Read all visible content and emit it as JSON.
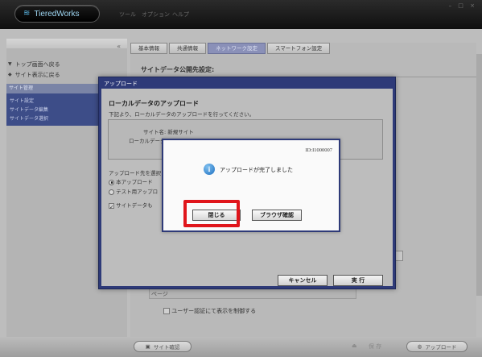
{
  "app": {
    "logo_text": "TieredWorks",
    "menu": [
      "ツール",
      "オプション",
      "ヘルプ"
    ],
    "window_controls": "– □ ×"
  },
  "sidebar": {
    "collapse": "«",
    "links": [
      {
        "label": "トップ画面へ戻る",
        "icon": "home-icon"
      },
      {
        "label": "サイト表示に戻る",
        "icon": "back-arrow-icon"
      }
    ],
    "section": "サイト管理",
    "items": [
      "サイト設定",
      "サイトデータ編集",
      "サイトデータ選択"
    ]
  },
  "tabs": [
    "基本情報",
    "共通情報",
    "ネットワーク設定",
    "スマートフォン設定"
  ],
  "active_tab_index": 2,
  "main": {
    "section_title": "サイトデータ公開先設定:",
    "auth_label": "ユーザー認証にて表示を制御する",
    "field_label": "ページ"
  },
  "bottom": {
    "site_check": "サイト確認",
    "save": "保 存",
    "upload": "アップロード"
  },
  "upload_dialog": {
    "title": "アップロード",
    "heading": "ローカルデータのアップロード",
    "subtitle": "下記より、ローカルデータのアップロードを行ってください。",
    "site_name_label": "サイト名: 新規サイト",
    "local_data_label": "ローカルデータ",
    "destination_label": "アップロード先を選択",
    "options": [
      {
        "label": "本アップロード",
        "selected": true
      },
      {
        "label": "テスト用アップロ",
        "selected": false
      }
    ],
    "check_label": "サイトデータも",
    "cancel": "キャンセル",
    "execute": "実 行"
  },
  "message_box": {
    "id": "ID:I1000007",
    "text": "アップロードが完了しました",
    "close": "閉じる",
    "browser_check": "ブラウザ確認"
  },
  "colors": {
    "dialog_frame": "#2e3a78",
    "active_tab": "#8a90b8",
    "highlight": "#e0151b"
  }
}
